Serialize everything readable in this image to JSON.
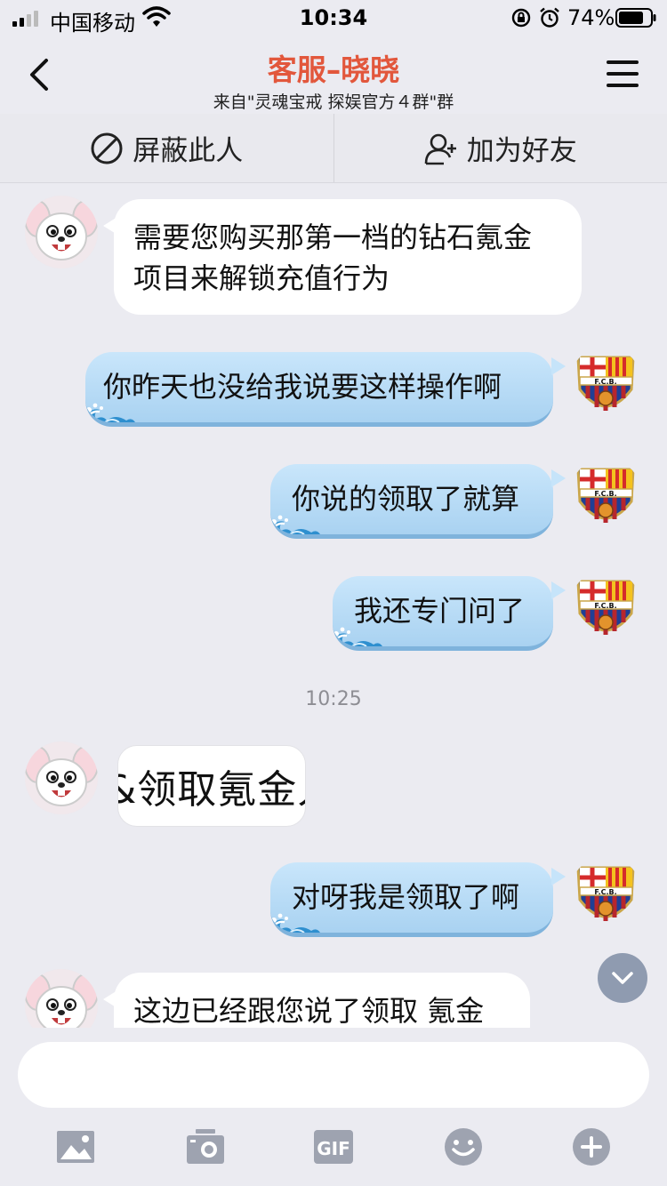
{
  "status_bar": {
    "carrier": "中国移动",
    "time": "10:34",
    "battery": "74%"
  },
  "header": {
    "title": "客服–晓晓",
    "subtitle": "来自\"灵魂宝戒 探娱官方４群\"群"
  },
  "actions": {
    "block": "屏蔽此人",
    "add_friend": "加为好友"
  },
  "messages": {
    "m1": {
      "line1": "需要您购买那第一档的钻石氪金",
      "line2": "项目来解锁充值行为"
    },
    "m2": "你昨天也没给我说要这样操作啊",
    "m3": "你说的领取了就算",
    "m4": "我还专门问了",
    "timestamp": "10:25",
    "m5_image_text": "&领取氪金人",
    "m6": "对呀我是领取了啊",
    "m7": "这边已经跟您说了领取 氪金"
  },
  "input": {
    "placeholder": ""
  },
  "toolbar": {
    "gif_label": "GIF"
  },
  "colors": {
    "title": "#e2573c",
    "outgoing_bubble": "#b8dcf6",
    "incoming_bubble": "#ffffff",
    "background": "#ebebf1"
  },
  "icons": [
    "back-icon",
    "menu-icon",
    "block-icon",
    "add-friend-icon",
    "image-icon",
    "camera-icon",
    "gif-icon",
    "emoji-icon",
    "plus-icon",
    "chevron-down-icon"
  ]
}
